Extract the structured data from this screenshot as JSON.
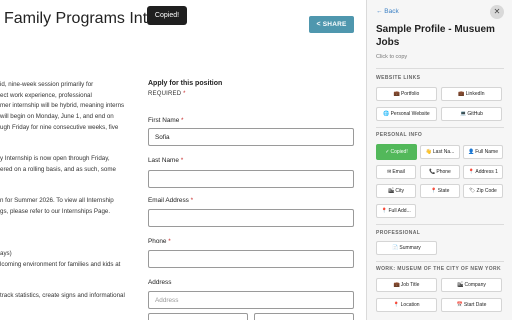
{
  "page": {
    "title": "Family Programs Interns",
    "share_label": "SHARE",
    "toast": "Copied!",
    "description_lines": [
      "id, nine-week session primarily for",
      "ect work experience, professional",
      "mer internship will be hybrid, meaning interns",
      "will begin on Monday, June 1, and end on",
      "ugh Friday for nine consecutive weeks, five",
      "",
      "",
      "y Internship is now open through Friday,",
      "ered on a rolling basis, and as such, some",
      "",
      "",
      "",
      "n for Summer 2026. To view all Internship",
      "gs, please refer to our Internships Page.",
      "",
      "",
      "ays)",
      "lcoming environment for families and kids at",
      "",
      "",
      "track statistics, create signs and informational"
    ]
  },
  "form": {
    "heading": "Apply for this position",
    "required_note": "REQUIRED",
    "fields": {
      "first_name": {
        "label": "First Name",
        "value": "Sofia",
        "required": true
      },
      "last_name": {
        "label": "Last Name",
        "value": "",
        "required": true
      },
      "email": {
        "label": "Email Address",
        "value": "",
        "required": true
      },
      "phone": {
        "label": "Phone",
        "value": "",
        "required": true
      },
      "address": {
        "label": "Address",
        "placeholder": "Address",
        "required": false
      }
    }
  },
  "panel": {
    "back": "← Back",
    "close": "✕",
    "title": "Sample Profile - Musuem Jobs",
    "click_to_copy": "Click to copy",
    "sections": {
      "website_links": "WEBSITE LINKS",
      "personal_info": "PERSONAL INFO",
      "professional": "PROFESSIONAL",
      "work": "WORK: MUSEUM OF THE CITY OF NEW YORK"
    },
    "chips": {
      "portfolio": "Portfolio",
      "linkedin": "LinkedIn",
      "personal_website": "Personal Website",
      "github": "GitHub",
      "copied": "Copied!",
      "last_name": "Last Na...",
      "full_name": "Full Name",
      "email": "Email",
      "phone": "Phone",
      "address1": "Address 1",
      "city": "City",
      "state": "State",
      "zip": "Zip Code",
      "full_address": "Full Add...",
      "summary": "Summary",
      "job_title": "Job Title",
      "company": "Company",
      "location": "Location",
      "start_date": "Start Date"
    },
    "icons": {
      "check": "✓",
      "suitcase": "💼",
      "globe": "🌐",
      "laptop": "💻",
      "hand": "👋",
      "person": "👤",
      "envelope": "✉",
      "phone": "📞",
      "pin": "📍",
      "buildings": "🏙",
      "tag": "🏷",
      "doc": "📄",
      "calendar": "📅"
    }
  }
}
